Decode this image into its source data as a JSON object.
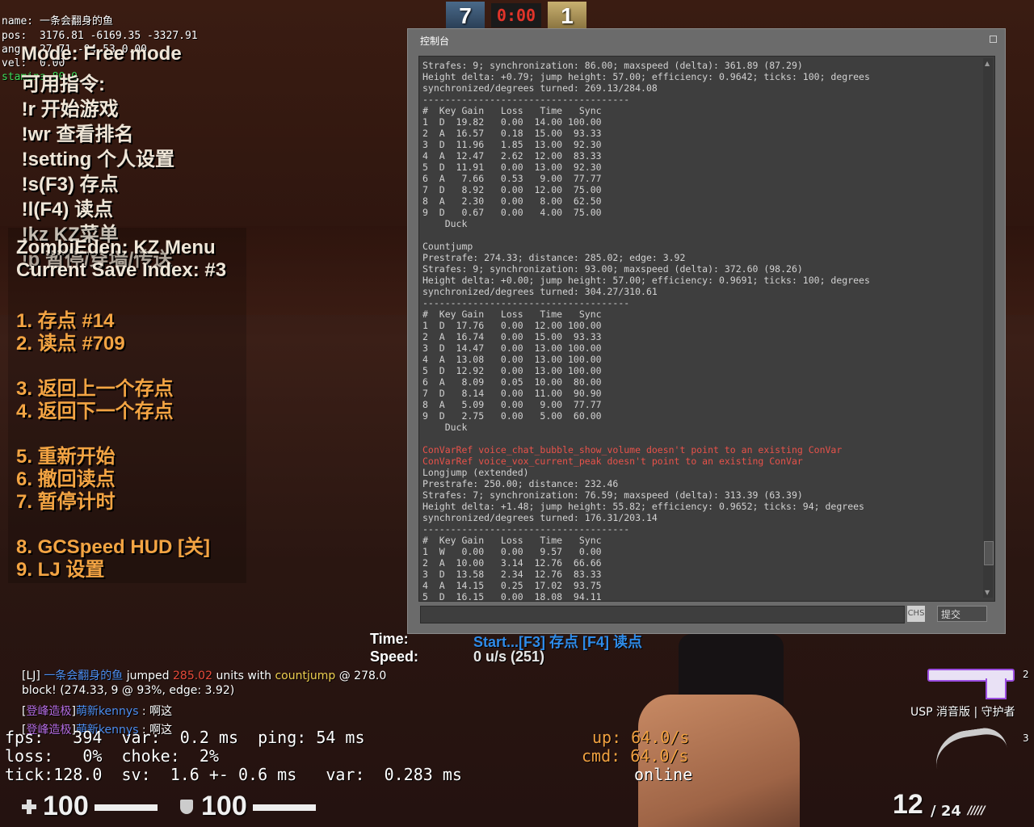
{
  "debug": {
    "name": "name: 一条会翻身的鱼",
    "pos": "pos:  3176.81 -6169.35 -3327.91",
    "ang": "ang:  27.71 -94.53 0.00",
    "vel": "vel:  0.00",
    "stamina": "stamina 80.0"
  },
  "help": {
    "mode": "Mode: Free mode",
    "lines": [
      "可用指令:",
      " !r 开始游戏",
      " !wr 查看排名",
      " !setting 个人设置",
      " !s(F3) 存点",
      " !l(F4) 读点",
      " !kz KZ菜单",
      " !p 暂停/穿墙/传送"
    ]
  },
  "kzmenu": {
    "title": "ZombiEden: KZ Menu",
    "subtitle": "Current Save Index: #3",
    "items": [
      "1. 存点 #14",
      "2. 读点 #709",
      "3. 返回上一个存点",
      "4. 返回下一个存点",
      "5. 重新开始",
      "6. 撤回读点",
      "7. 暂停计时",
      "8. GCSpeed HUD [关]",
      "9. LJ 设置"
    ]
  },
  "scoreboard": {
    "ct_score": "7",
    "t_score": "1",
    "timer": "0:00"
  },
  "console": {
    "title": "控制台",
    "ime": "CHS",
    "submit": "提交",
    "lines": [
      {
        "t": "Strafes: 9; synchronization: 86.00; maxspeed (delta): 361.89 (87.29)",
        "e": false
      },
      {
        "t": "Height delta: +0.79; jump height: 57.00; efficiency: 0.9642; ticks: 100; degrees",
        "e": false
      },
      {
        "t": "synchronized/degrees turned: 269.13/284.08",
        "e": false
      },
      {
        "t": "-------------------------------------",
        "e": false
      },
      {
        "t": "#  Key Gain   Loss   Time   Sync",
        "e": false
      },
      {
        "t": "1  D  19.82   0.00  14.00 100.00",
        "e": false
      },
      {
        "t": "2  A  16.57   0.18  15.00  93.33",
        "e": false
      },
      {
        "t": "3  D  11.96   1.85  13.00  92.30",
        "e": false
      },
      {
        "t": "4  A  12.47   2.62  12.00  83.33",
        "e": false
      },
      {
        "t": "5  D  11.91   0.00  13.00  92.30",
        "e": false
      },
      {
        "t": "6  A   7.66   0.53   9.00  77.77",
        "e": false
      },
      {
        "t": "7  D   8.92   0.00  12.00  75.00",
        "e": false
      },
      {
        "t": "8  A   2.30   0.00   8.00  62.50",
        "e": false
      },
      {
        "t": "9  D   0.67   0.00   4.00  75.00",
        "e": false
      },
      {
        "t": "    Duck",
        "e": false
      },
      {
        "t": "",
        "e": false
      },
      {
        "t": "Countjump",
        "e": false
      },
      {
        "t": "Prestrafe: 274.33; distance: 285.02; edge: 3.92",
        "e": false
      },
      {
        "t": "Strafes: 9; synchronization: 93.00; maxspeed (delta): 372.60 (98.26)",
        "e": false
      },
      {
        "t": "Height delta: +0.00; jump height: 57.00; efficiency: 0.9691; ticks: 100; degrees",
        "e": false
      },
      {
        "t": "synchronized/degrees turned: 304.27/310.61",
        "e": false
      },
      {
        "t": "-------------------------------------",
        "e": false
      },
      {
        "t": "#  Key Gain   Loss   Time   Sync",
        "e": false
      },
      {
        "t": "1  D  17.76   0.00  12.00 100.00",
        "e": false
      },
      {
        "t": "2  A  16.74   0.00  15.00  93.33",
        "e": false
      },
      {
        "t": "3  D  14.47   0.00  13.00 100.00",
        "e": false
      },
      {
        "t": "4  A  13.08   0.00  13.00 100.00",
        "e": false
      },
      {
        "t": "5  D  12.92   0.00  13.00 100.00",
        "e": false
      },
      {
        "t": "6  A   8.09   0.05  10.00  80.00",
        "e": false
      },
      {
        "t": "7  D   8.14   0.00  11.00  90.90",
        "e": false
      },
      {
        "t": "8  A   5.09   0.00   9.00  77.77",
        "e": false
      },
      {
        "t": "9  D   2.75   0.00   5.00  60.00",
        "e": false
      },
      {
        "t": "    Duck",
        "e": false
      },
      {
        "t": "",
        "e": false
      },
      {
        "t": "ConVarRef voice_chat_bubble_show_volume doesn't point to an existing ConVar",
        "e": true
      },
      {
        "t": "ConVarRef voice_vox_current_peak doesn't point to an existing ConVar",
        "e": true
      },
      {
        "t": "Longjump (extended)",
        "e": false
      },
      {
        "t": "Prestrafe: 250.00; distance: 232.46",
        "e": false
      },
      {
        "t": "Strafes: 7; synchronization: 76.59; maxspeed (delta): 313.39 (63.39)",
        "e": false
      },
      {
        "t": "Height delta: +1.48; jump height: 55.82; efficiency: 0.9652; ticks: 94; degrees",
        "e": false
      },
      {
        "t": "synchronized/degrees turned: 176.31/203.14",
        "e": false
      },
      {
        "t": "-------------------------------------",
        "e": false
      },
      {
        "t": "#  Key Gain   Loss   Time   Sync",
        "e": false
      },
      {
        "t": "1  W   0.00   0.00   9.57   0.00",
        "e": false
      },
      {
        "t": "2  A  10.00   3.14  12.76  66.66",
        "e": false
      },
      {
        "t": "3  D  13.58   2.34  12.76  83.33",
        "e": false
      },
      {
        "t": "4  A  14.15   0.25  17.02  93.75",
        "e": false
      },
      {
        "t": "5  D  16.15   0.00  18.08  94.11",
        "e": false
      }
    ]
  },
  "timer_hud": {
    "time_label": "Time:",
    "time_value": "Start...[F3] 存点 [F4] 读点",
    "speed_label": "Speed:",
    "speed_value": "0 u/s (251)"
  },
  "chat": {
    "lj_prefix": "[LJ] ",
    "lj_player": "一条会翻身的鱼",
    "lj_mid": " jumped ",
    "lj_dist": "285.02",
    "lj_mid2": " units with ",
    "lj_type": "countjump",
    "lj_pre": " @ 278.0",
    "block_line": "block! (274.33, 9 @ 93%, edge: 3.92)",
    "msg1_tag": "登峰造极",
    "msg1_name": "萌新kennys",
    "msg1_text": " : 啊这",
    "msg2_tag": "登峰造极",
    "msg2_name": "萌新kennys",
    "msg2_text": " : 啊这"
  },
  "netgraph": {
    "line1": "fps:   394  var:  0.2 ms  ping: 54 ms",
    "line2": "loss:   0%  choke:  2%",
    "line3": "tick:128.0  sv:  1.6 +- 0.6 ms   var:  0.283 ms",
    "up": "up: 64.0/s",
    "cmd": "cmd: 64.0/s",
    "online": "online"
  },
  "hud": {
    "health": "100",
    "armor": "100",
    "ammo": "12",
    "reserve": "/ 24",
    "weapon_name": "USP 消音版 | 守护者",
    "slot2": "2",
    "slot3": "3"
  }
}
